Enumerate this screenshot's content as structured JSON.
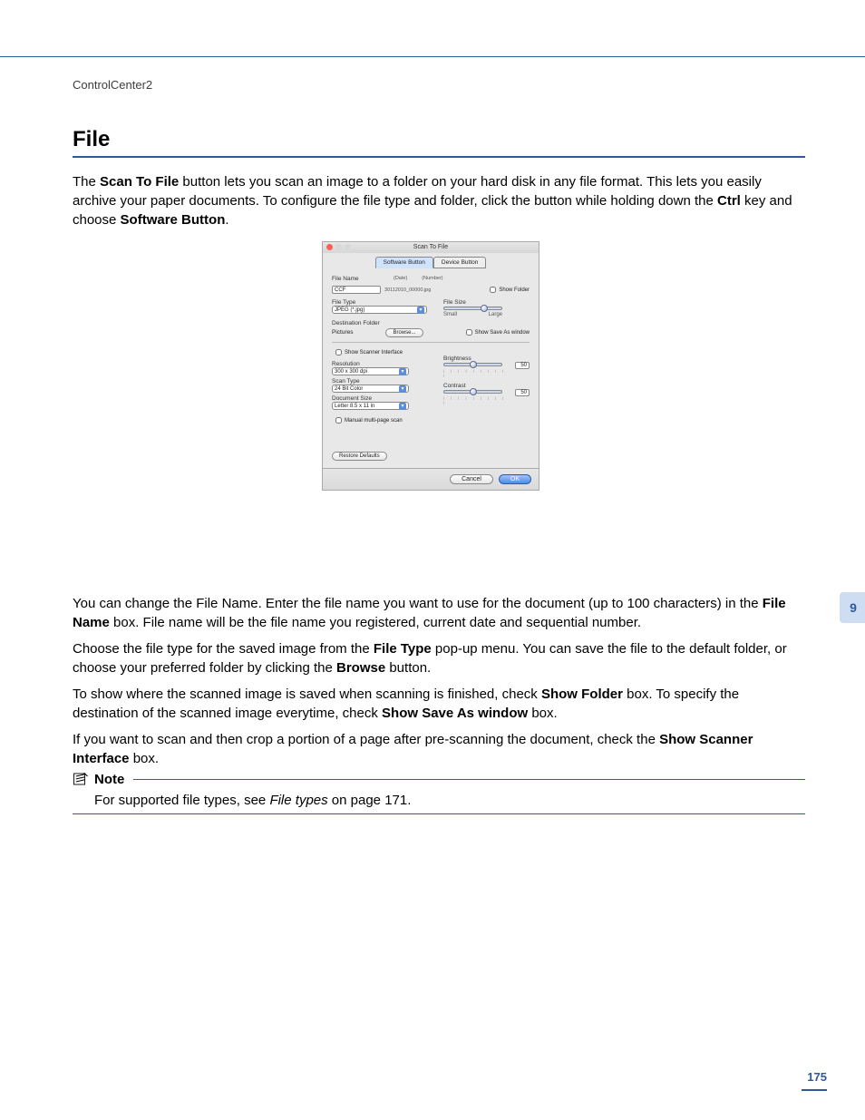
{
  "header": "ControlCenter2",
  "section_title": "File",
  "chapter_tab": "9",
  "page_number": "175",
  "para1_parts": [
    "The ",
    "Scan To File",
    " button lets you scan an image to a folder on your hard disk in any file format. This lets you easily archive your paper documents. To configure the file type and folder, click the button while holding down the ",
    "Ctrl",
    " key and choose ",
    "Software Button",
    "."
  ],
  "para2_parts": [
    "You can change the File Name. Enter the file name you want to use for the document (up to 100 characters) in the ",
    "File Name",
    " box. File name will be the file name you registered, current date and sequential number."
  ],
  "para3_parts": [
    "Choose the file type for the saved image from the ",
    "File Type",
    " pop-up menu. You can save the file to the default folder, or choose your preferred folder by clicking the ",
    "Browse",
    " button."
  ],
  "para4_parts": [
    "To show where the scanned image is saved when scanning is finished, check ",
    "Show Folder",
    " box. To specify the destination of the scanned image everytime, check ",
    "Show Save As window",
    " box."
  ],
  "para5_parts": [
    "If you want to scan and then crop a portion of a page after pre-scanning the document, check the ",
    "Show Scanner Interface",
    " box."
  ],
  "note": {
    "title": "Note",
    "text_parts": [
      "For supported file types, see ",
      "File types",
      " on page 171."
    ]
  },
  "dialog": {
    "title": "Scan To File",
    "tabs": [
      "Software Button",
      "Device Button"
    ],
    "active_tab": 0,
    "filename_label": "File Name",
    "filename_date_label": "(Date)",
    "filename_num_label": "(Number)",
    "filename_value": "CCF",
    "filename_suffix": "30112010_00000.jpg",
    "show_folder_label": "Show Folder",
    "filetype_label": "File Type",
    "filetype_value": "JPEG (*.jpg)",
    "filesize_label": "File Size",
    "filesize_small": "Small",
    "filesize_large": "Large",
    "dest_label": "Destination Folder",
    "dest_value": "Pictures",
    "browse_button": "Browse...",
    "show_saveas_label": "Show Save As window",
    "show_scanner_label": "Show Scanner Interface",
    "resolution_label": "Resolution",
    "resolution_value": "300 x 300 dpi",
    "scantype_label": "Scan Type",
    "scantype_value": "24 Bit Color",
    "docsize_label": "Document Size",
    "docsize_value": "Letter  8.5 x 11 in",
    "manual_label": "Manual multi-page scan",
    "brightness_label": "Brightness",
    "brightness_value": "50",
    "contrast_label": "Contrast",
    "contrast_value": "50",
    "restore_button": "Restore Defaults",
    "cancel_button": "Cancel",
    "ok_button": "OK"
  }
}
